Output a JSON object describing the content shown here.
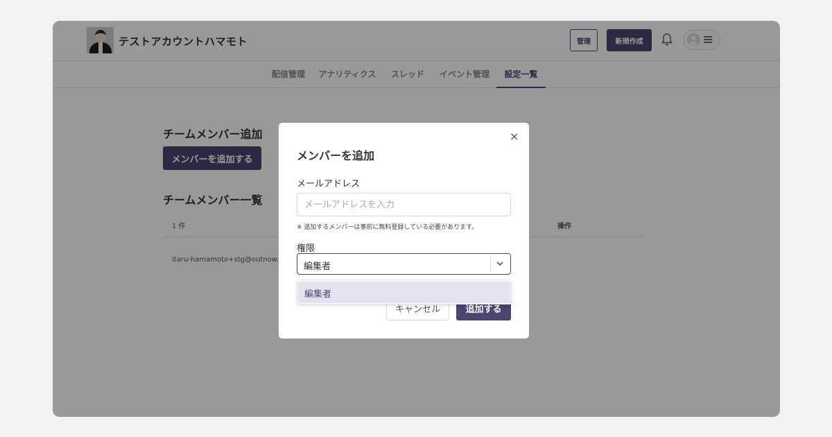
{
  "header": {
    "account_name": "テストアカウントハマモト",
    "admin_button": "管理",
    "new_button": "新規作成"
  },
  "tabs": [
    {
      "label": "配信管理"
    },
    {
      "label": "アナリティクス"
    },
    {
      "label": "スレッド"
    },
    {
      "label": "イベント管理"
    },
    {
      "label": "設定一覧",
      "active": true
    }
  ],
  "page": {
    "add_section_title": "チームメンバー追加",
    "add_member_button": "メンバーを追加する",
    "list_section_title": "チームメンバー一覧",
    "count_label": "1 件",
    "ops_header": "操作",
    "members": [
      {
        "email": "itaru-hamamoto+stg@outnow.jp"
      }
    ]
  },
  "modal": {
    "close_glyph": "×",
    "title": "メンバーを追加",
    "email_label": "メールアドレス",
    "email_placeholder": "メールアドレスを入力",
    "email_value": "",
    "note": "※ 追加するメンバーは事前に無料登録している必要があります。",
    "role_label": "権限",
    "role_selected": "編集者",
    "role_options": [
      "編集者"
    ],
    "cancel_button": "キャンセル",
    "submit_button": "追加する"
  },
  "colors": {
    "accent": "#4a4671",
    "overlay": "rgba(0,0,0,0.40)",
    "option_highlight": "#e3e2f1"
  },
  "icons": {
    "close": "close-icon",
    "bell": "bell-icon",
    "chevron": "chevron-down-icon",
    "menu": "hamburger-icon"
  }
}
